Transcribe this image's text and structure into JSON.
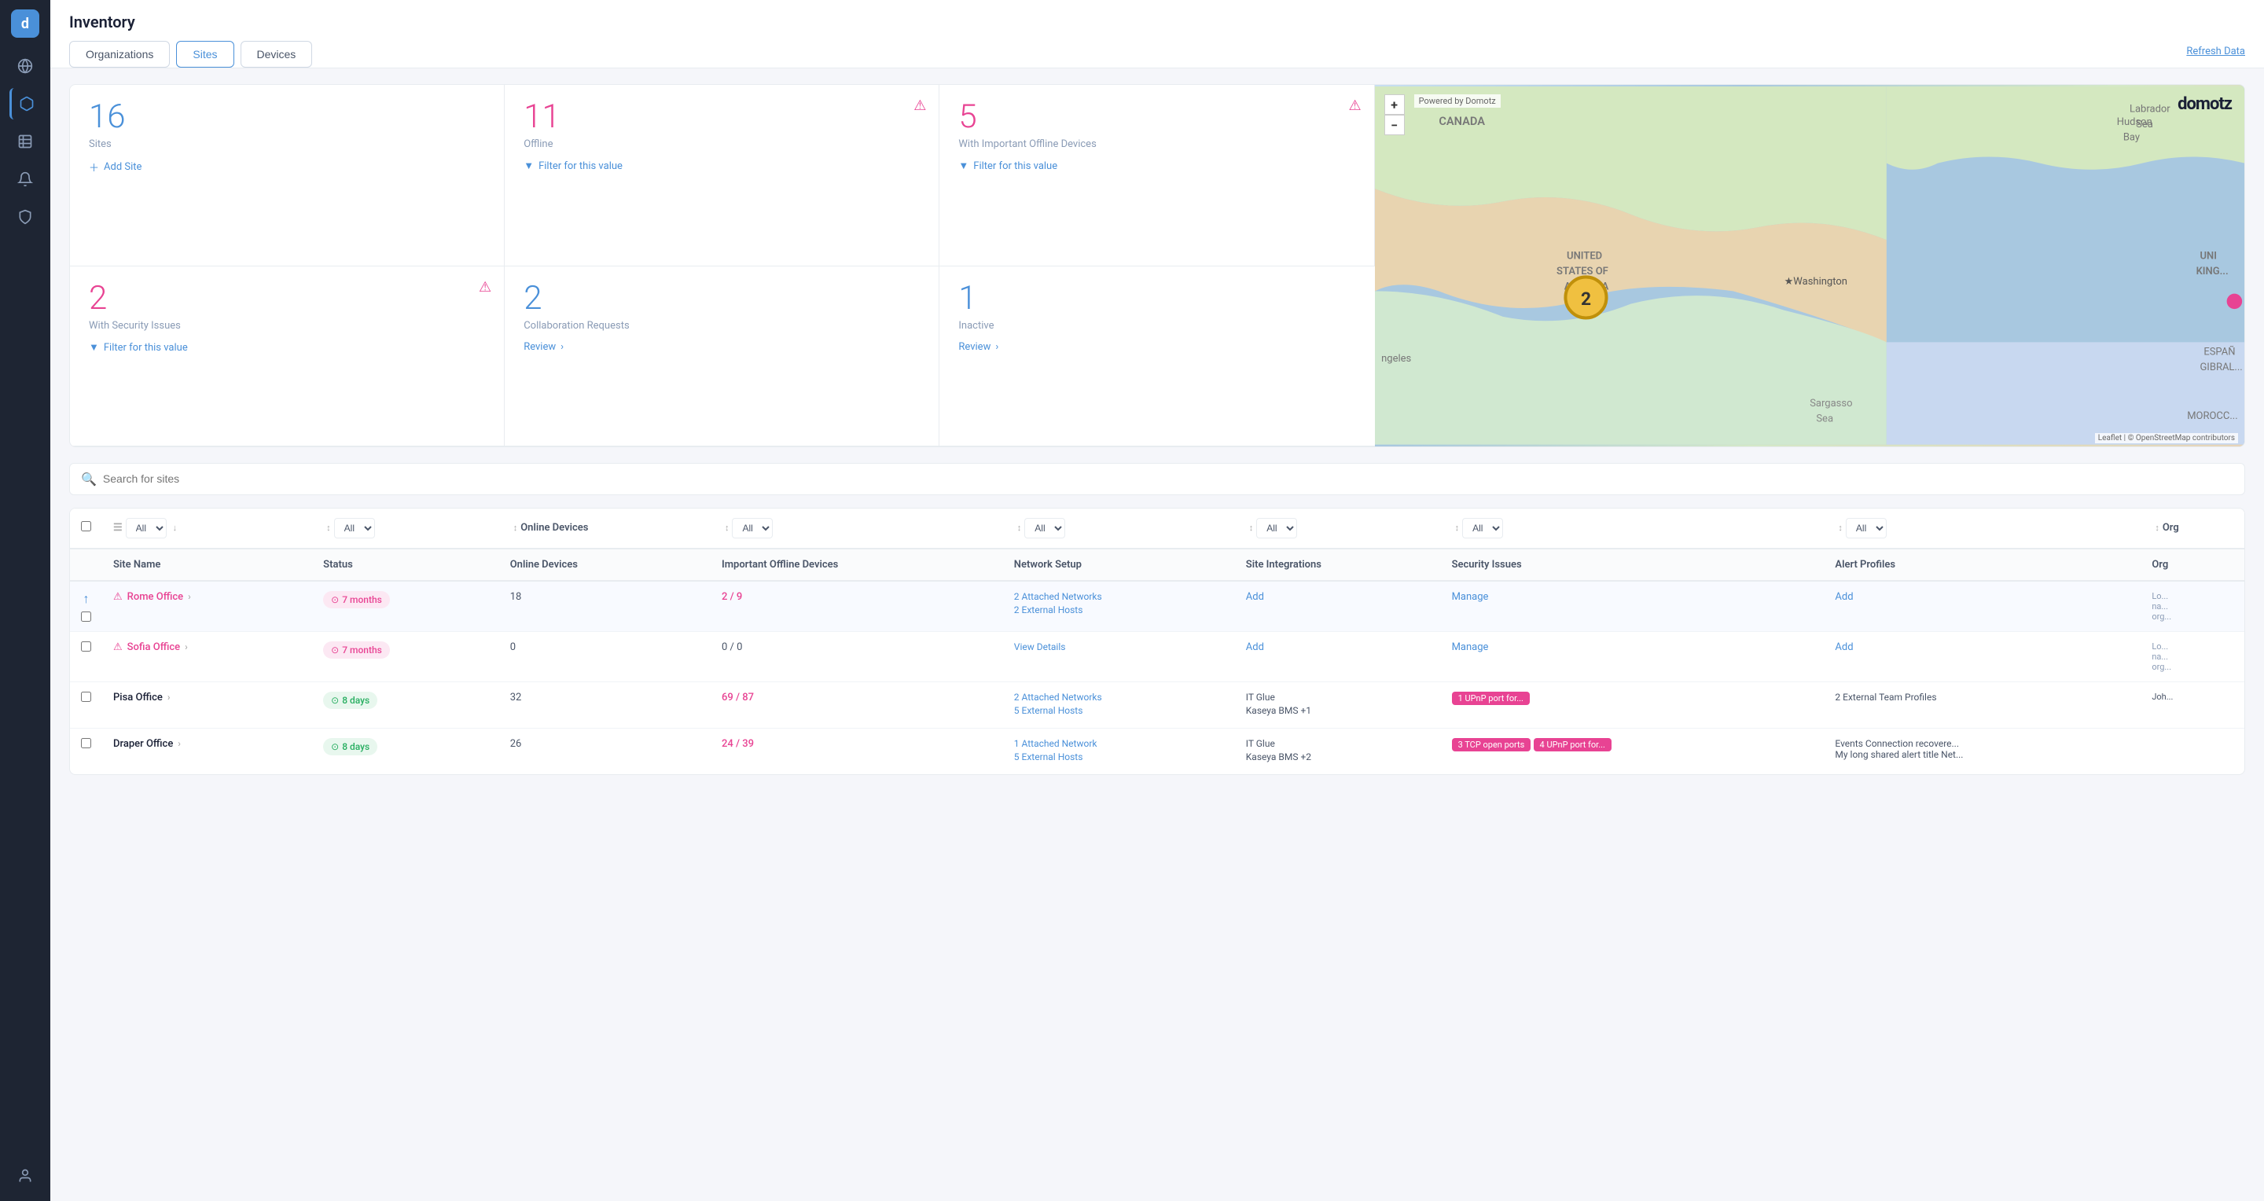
{
  "app": {
    "logo": "d",
    "title": "Inventory"
  },
  "sidebar": {
    "icons": [
      {
        "name": "globe-icon",
        "glyph": "🌐",
        "active": false
      },
      {
        "name": "cube-icon",
        "glyph": "⬡",
        "active": true
      },
      {
        "name": "table-icon",
        "glyph": "▦",
        "active": false
      },
      {
        "name": "bell-icon",
        "glyph": "🔔",
        "active": false
      },
      {
        "name": "shield-icon",
        "glyph": "🛡",
        "active": false
      },
      {
        "name": "user-icon",
        "glyph": "👤",
        "active": false
      }
    ]
  },
  "header": {
    "title": "Inventory",
    "refresh_label": "Refresh Data"
  },
  "tabs": [
    {
      "label": "Organizations",
      "active": false
    },
    {
      "label": "Sites",
      "active": true
    },
    {
      "label": "Devices",
      "active": false
    }
  ],
  "stats": [
    {
      "number": "16",
      "number_color": "blue",
      "label": "Sites",
      "action_type": "add",
      "action_label": "Add Site",
      "alert": false,
      "row": 1
    },
    {
      "number": "11",
      "number_color": "pink",
      "label": "Offline",
      "action_type": "filter",
      "action_label": "Filter for this value",
      "alert": true,
      "row": 1
    },
    {
      "number": "5",
      "number_color": "pink",
      "label": "With Important Offline Devices",
      "action_type": "filter",
      "action_label": "Filter for this value",
      "alert": true,
      "row": 1
    },
    {
      "number": "2",
      "number_color": "pink",
      "label": "With Security Issues",
      "action_type": "filter",
      "action_label": "Filter for this value",
      "alert": true,
      "row": 2
    },
    {
      "number": "2",
      "number_color": "blue",
      "label": "Collaboration Requests",
      "action_type": "review",
      "action_label": "Review",
      "alert": false,
      "row": 2
    },
    {
      "number": "1",
      "number_color": "blue",
      "label": "Inactive",
      "action_type": "review",
      "action_label": "Review",
      "alert": false,
      "row": 2
    }
  ],
  "map": {
    "powered_by": "Powered by Domotz",
    "logo": "domotz",
    "marker_count": "2",
    "attribution": "Leaflet | © OpenStreetMap contributors",
    "plus_btn": "+",
    "minus_btn": "−"
  },
  "search": {
    "placeholder": "Search for sites"
  },
  "table": {
    "columns": [
      {
        "label": "Site Name",
        "sortable": true
      },
      {
        "label": "Status",
        "sortable": true
      },
      {
        "label": "Online Devices",
        "sortable": true
      },
      {
        "label": "Important Offline Devices",
        "sortable": true
      },
      {
        "label": "Network Setup",
        "sortable": true
      },
      {
        "label": "Site Integrations",
        "sortable": true
      },
      {
        "label": "Security Issues",
        "sortable": true
      },
      {
        "label": "Alert Profiles",
        "sortable": true
      },
      {
        "label": "Org",
        "sortable": false
      }
    ],
    "filter_options": [
      "All"
    ],
    "rows": [
      {
        "pinned": true,
        "alert": true,
        "site_name": "Rome Office",
        "site_color": "pink",
        "status_type": "offline",
        "status_label": "7 months",
        "online_devices": "18",
        "offline_devices": "2 / 9",
        "networks": [
          "2 Attached Networks",
          "2 External Hosts"
        ],
        "integration": null,
        "security": null,
        "alerts": [
          "Add"
        ],
        "org_text": "Lo... na... org..."
      },
      {
        "pinned": false,
        "alert": true,
        "site_name": "Sofia Office",
        "site_color": "pink",
        "status_type": "offline",
        "status_label": "7 months",
        "online_devices": "0",
        "offline_devices": "0 / 0",
        "networks": [
          "View Details"
        ],
        "integration": null,
        "security": null,
        "alerts": [
          "Add"
        ],
        "org_text": "Lo... na... org..."
      },
      {
        "pinned": false,
        "alert": false,
        "site_name": "Pisa Office",
        "site_color": "black",
        "status_type": "online",
        "status_label": "8 days",
        "online_devices": "32",
        "offline_devices": "69 / 87",
        "networks": [
          "2 Attached Networks",
          "5 External Hosts"
        ],
        "integration": [
          "IT Glue",
          "Kaseya BMS +1"
        ],
        "security": [
          "1 UPnP port for..."
        ],
        "alerts": [
          "2 External Team Profiles"
        ],
        "org_text": "Joh..."
      },
      {
        "pinned": false,
        "alert": false,
        "site_name": "Draper Office",
        "site_color": "black",
        "status_type": "online",
        "status_label": "8 days",
        "online_devices": "26",
        "offline_devices": "24 / 39",
        "networks": [
          "1 Attached Network",
          "5 External Hosts"
        ],
        "integration": [
          "IT Glue",
          "Kaseya BMS +2"
        ],
        "security": [
          "3 TCP open ports",
          "4 UPnP port for..."
        ],
        "alerts": [
          "Events Connection recovere...",
          "My long shared alert title Net..."
        ],
        "org_text": ""
      }
    ]
  }
}
